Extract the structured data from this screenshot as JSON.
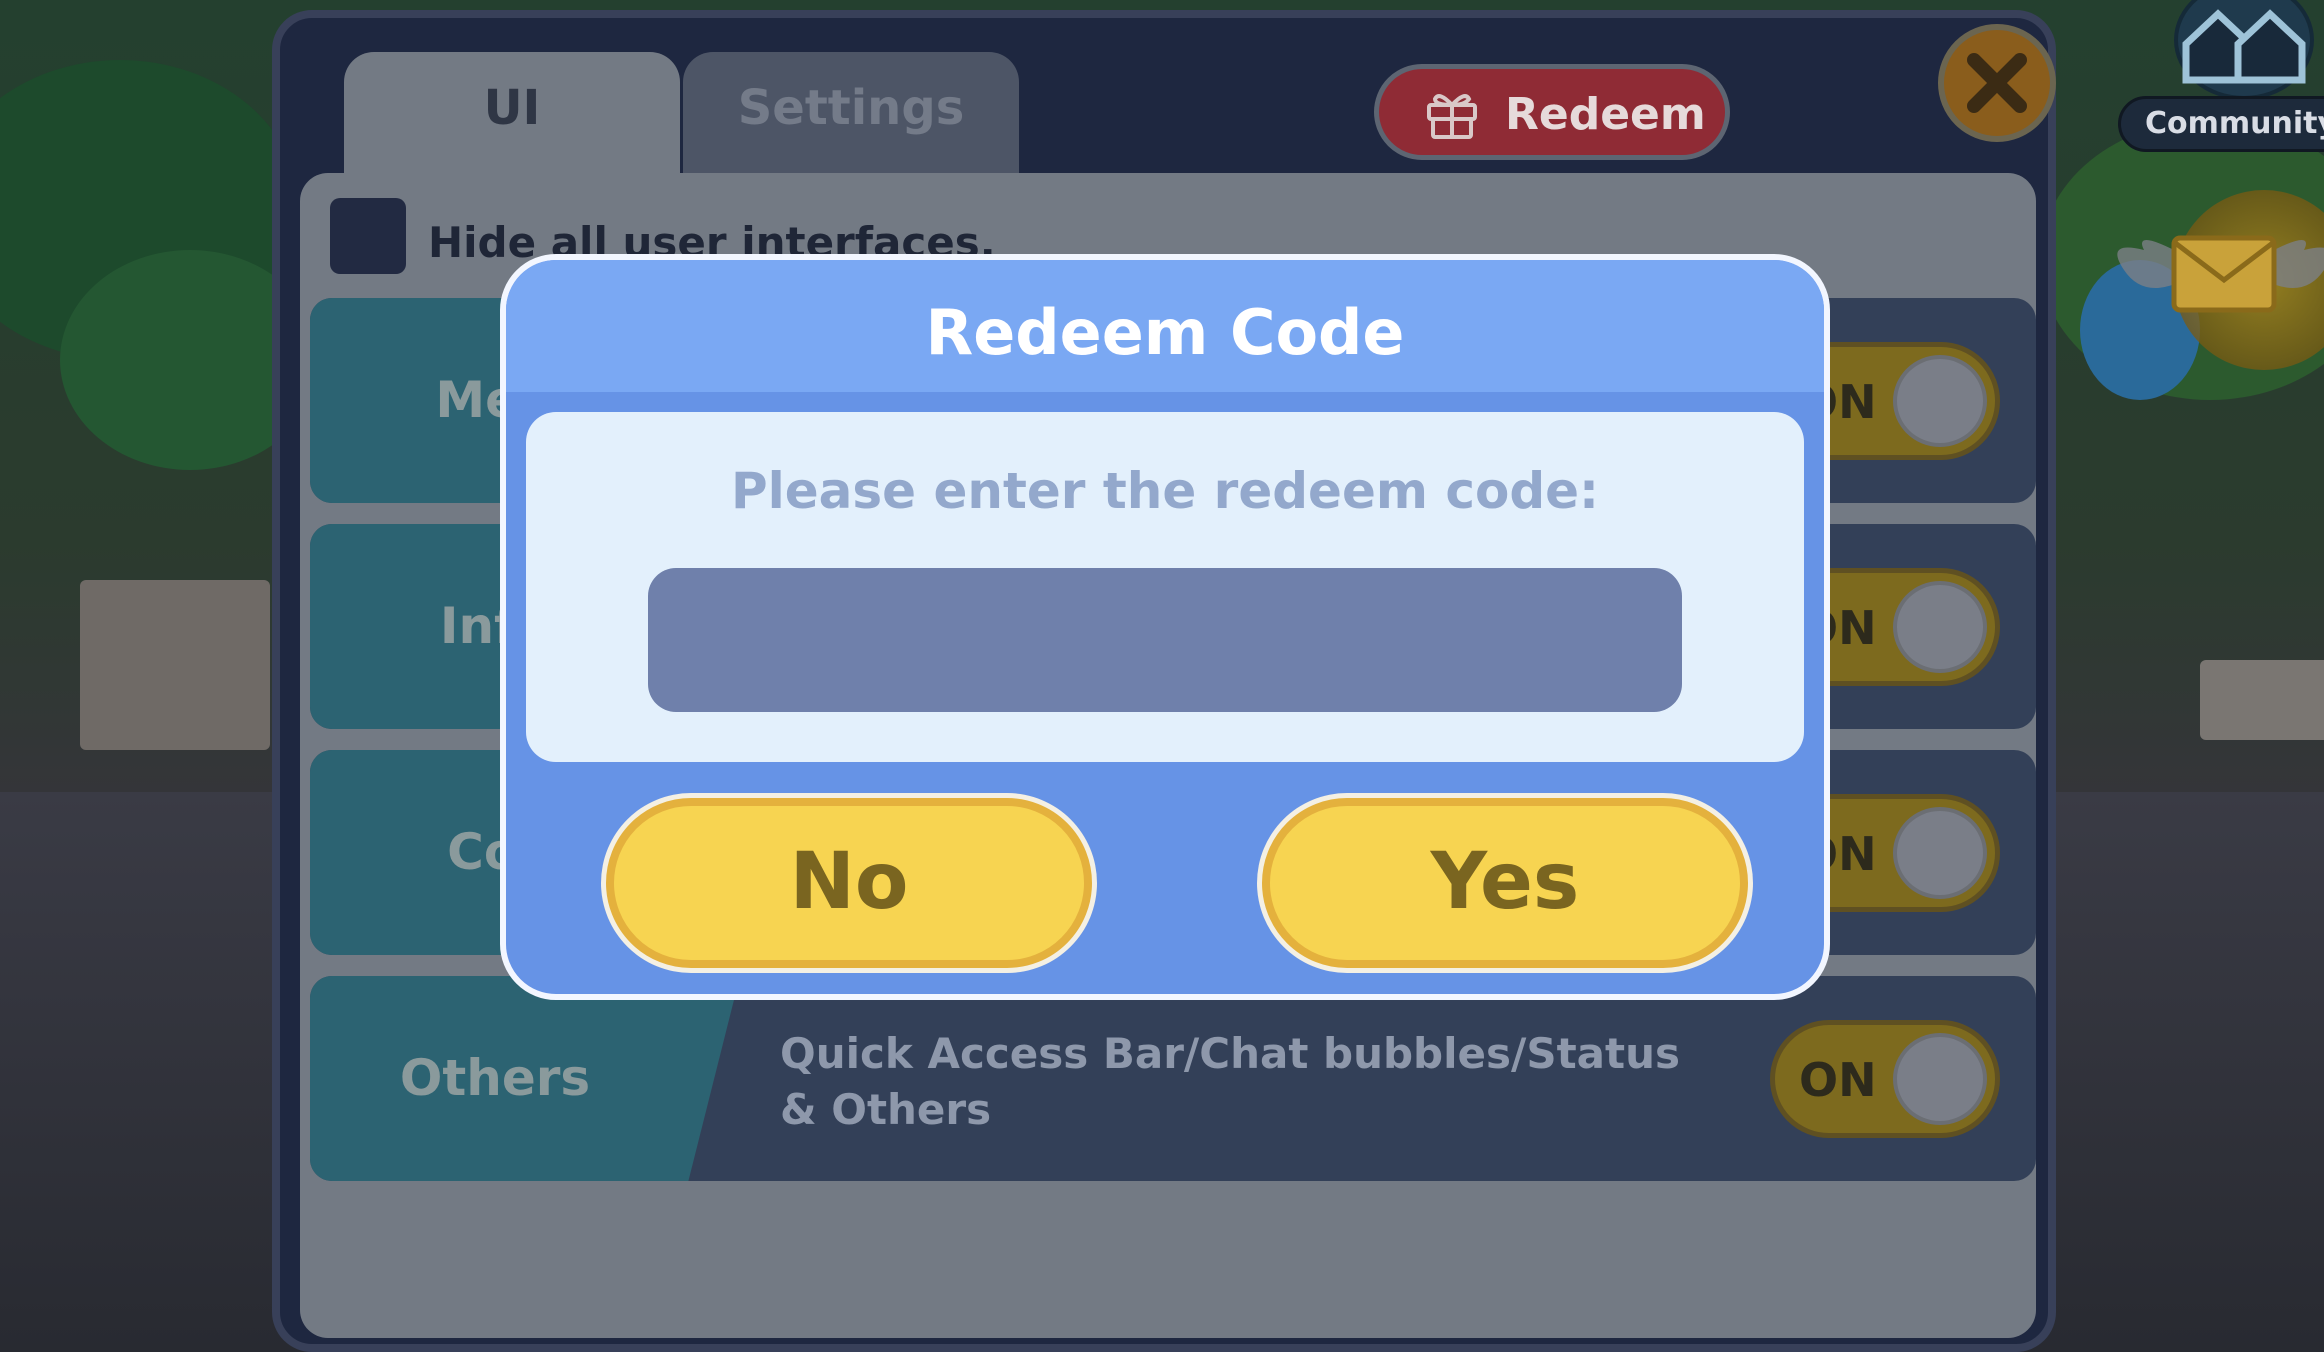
{
  "background": {
    "community_label": "Community"
  },
  "settings_panel": {
    "tabs": [
      {
        "label": "UI",
        "active": true
      },
      {
        "label": "Settings",
        "active": false
      }
    ],
    "redeem_button_label": "Redeem",
    "hide_all_checkbox_label": "Hide all user interfaces.",
    "rows": [
      {
        "category": "Men",
        "description": "",
        "toggle": "ON"
      },
      {
        "category": "Info",
        "description": "",
        "toggle": "ON"
      },
      {
        "category": "Cor",
        "description": "",
        "toggle": "ON"
      },
      {
        "category": "Others",
        "description": "Quick Access Bar/Chat bubbles/Status & Others",
        "toggle": "ON"
      }
    ]
  },
  "modal": {
    "title": "Redeem Code",
    "prompt": "Please enter the redeem code:",
    "input_value": "",
    "no_label": "No",
    "yes_label": "Yes"
  },
  "colors": {
    "modal_blue": "#6693e6",
    "button_yellow": "#f7d451",
    "redeem_red": "#8f2b35",
    "toggle_gold": "#7d6a1e"
  }
}
